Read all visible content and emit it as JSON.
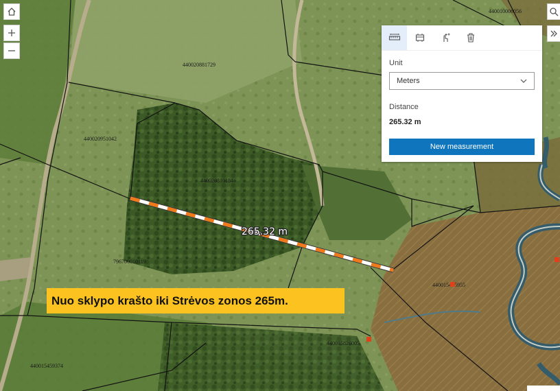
{
  "map": {
    "parcels": [
      {
        "id": "440020881729"
      },
      {
        "id": "440020951042"
      },
      {
        "id": "440020810184"
      },
      {
        "id": "796700010119"
      },
      {
        "id": "440015459374"
      },
      {
        "id": "440015826005"
      },
      {
        "id": "440010006056"
      },
      {
        "id": "440015465955"
      }
    ],
    "measurement_label": "265.32 m",
    "colors": {
      "measure_a": "#f07a1a",
      "measure_b": "#ffffff",
      "boundary": "#111111",
      "marker": "#e0401a"
    }
  },
  "controls": {
    "home_icon": "home-icon",
    "zoom_in_icon": "plus-icon",
    "zoom_out_icon": "minus-icon",
    "search_icon": "search-icon",
    "expand_icon": "double-chevron-right-icon"
  },
  "panel": {
    "tools": [
      "distance-measure-icon",
      "area-measure-icon",
      "add-point-icon",
      "trash-icon"
    ],
    "unit_label": "Unit",
    "unit_value": "Meters",
    "distance_label": "Distance",
    "distance_value": "265.32 m",
    "new_button": "New measurement",
    "accent": "#0f75bc"
  },
  "caption": {
    "text": "Nuo sklypo krašto iki Strėvos zonos 265m.",
    "background": "#fcc320"
  }
}
